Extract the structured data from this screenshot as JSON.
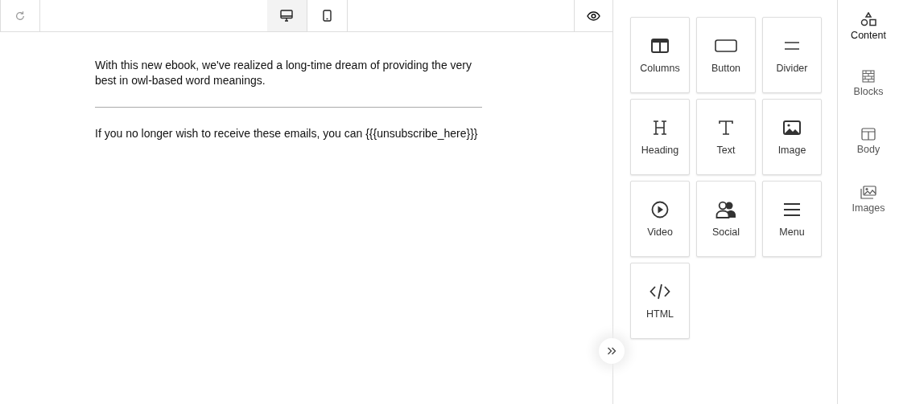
{
  "toolbar": {
    "devices": [
      {
        "kind": "desktop",
        "selected": true
      },
      {
        "kind": "mobile",
        "selected": false
      }
    ]
  },
  "email": {
    "paragraph": "With this new ebook, we've realized a long-time dream of providing the very best in owl-based word meanings.",
    "footer": "If you no longer wish to receive these emails, you can {{{unsubscribe_here}}}"
  },
  "tools": [
    {
      "label": "Columns",
      "kind": "columns"
    },
    {
      "label": "Button",
      "kind": "button"
    },
    {
      "label": "Divider",
      "kind": "divider"
    },
    {
      "label": "Heading",
      "kind": "heading"
    },
    {
      "label": "Text",
      "kind": "text"
    },
    {
      "label": "Image",
      "kind": "image"
    },
    {
      "label": "Video",
      "kind": "video"
    },
    {
      "label": "Social",
      "kind": "social"
    },
    {
      "label": "Menu",
      "kind": "menu"
    },
    {
      "label": "HTML",
      "kind": "html"
    }
  ],
  "tabs": [
    {
      "label": "Content",
      "kind": "content",
      "selected": true
    },
    {
      "label": "Blocks",
      "kind": "blocks",
      "selected": false
    },
    {
      "label": "Body",
      "kind": "body",
      "selected": false
    },
    {
      "label": "Images",
      "kind": "images",
      "selected": false
    }
  ]
}
